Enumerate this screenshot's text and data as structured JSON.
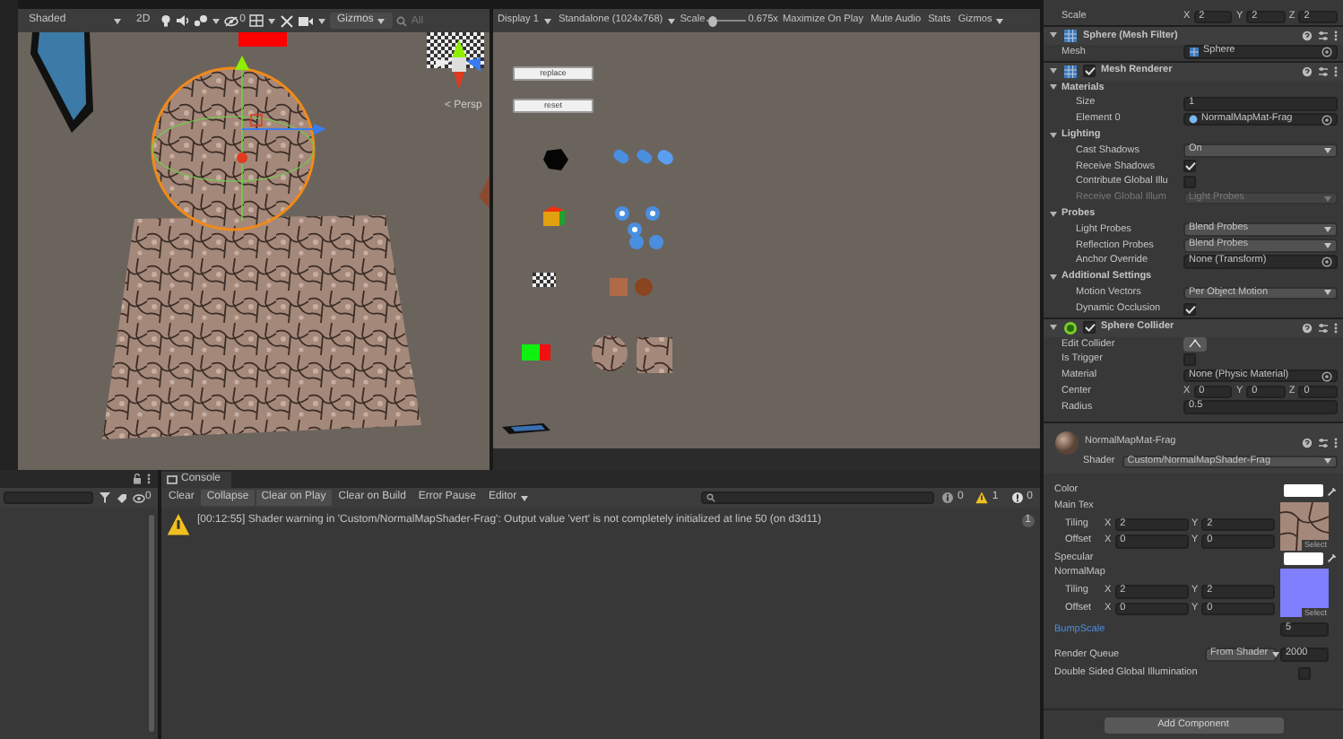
{
  "scene": {
    "toolbar": {
      "shading": "Shaded",
      "mode_2d": "2D",
      "effects_count": "0",
      "gizmos": "Gizmos",
      "search_placeholder": "All"
    },
    "camera_label": "< Persp"
  },
  "game": {
    "toolbar": {
      "display": "Display 1",
      "resolution": "Standalone (1024x768)",
      "scale_label": "Scale",
      "scale": {
        "level": 0.06
      },
      "scale_value": "0.675x",
      "toggles": [
        {
          "label": "Maximize On Play",
          "selected": false
        },
        {
          "label": "Mute Audio",
          "selected": false
        },
        {
          "label": "Stats",
          "selected": false
        }
      ],
      "gizmos": "Gizmos"
    },
    "ui_buttons": [
      "replace",
      "reset"
    ]
  },
  "hierarchy": {
    "hidden_count": "0"
  },
  "console": {
    "title": "Console",
    "toolbar": [
      {
        "label": "Clear",
        "selected": false
      },
      {
        "label": "Collapse",
        "selected": true
      },
      {
        "label": "Clear on Play",
        "selected": true
      },
      {
        "label": "Clear on Build",
        "selected": false
      },
      {
        "label": "Error Pause",
        "selected": false
      }
    ],
    "editor": "Editor",
    "counts": [
      {
        "kind": "info",
        "value": "0"
      },
      {
        "kind": "warning",
        "value": "1"
      },
      {
        "kind": "error",
        "value": "0"
      }
    ],
    "messages": [
      {
        "kind": "warning",
        "text": "[00:12:55] Shader warning in 'Custom/NormalMapShader-Frag': Output value 'vert' is not completely initialized at line 50 (on d3d11)",
        "count": "1"
      }
    ]
  },
  "inspector": {
    "rows": [
      {
        "kind": "vector",
        "label": "Scale",
        "values": [
          {
            "axis": "X",
            "value": "2"
          },
          {
            "axis": "Y",
            "value": "2"
          },
          {
            "axis": "Z",
            "value": "2"
          }
        ]
      },
      {
        "kind": "mesh_component",
        "title": "Sphere (Mesh Filter)"
      },
      {
        "kind": "mesh_object",
        "label": "Mesh",
        "value": "Sphere"
      },
      {
        "kind": "mesh_component",
        "title": "Mesh Renderer",
        "enabled": true
      },
      {
        "kind": "section",
        "label": "Materials",
        "expanded": true,
        "children": [
          {
            "kind": "field",
            "label": "Size",
            "value": "1"
          },
          {
            "kind": "material_object",
            "label": "Element 0",
            "value": "NormalMapMat-Frag"
          }
        ]
      },
      {
        "kind": "section",
        "label": "Lighting",
        "expanded": true,
        "children": [
          {
            "kind": "dropdown",
            "label": "Cast Shadows",
            "value": "On",
            "disabled": false
          },
          {
            "kind": "check",
            "label": "Receive Shadows",
            "checked": true
          },
          {
            "kind": "check",
            "label": "Contribute Global Illu",
            "checked": false
          },
          {
            "kind": "dropdown",
            "label": "Receive Global Illum",
            "value": "Light Probes",
            "disabled": true
          }
        ]
      },
      {
        "kind": "section",
        "label": "Probes",
        "expanded": true,
        "children": [
          {
            "kind": "dropdown",
            "label": "Light Probes",
            "value": "Blend Probes",
            "disabled": false
          },
          {
            "kind": "dropdown",
            "label": "Reflection Probes",
            "value": "Blend Probes",
            "disabled": false
          },
          {
            "kind": "object",
            "label": "Anchor Override",
            "value": "None (Transform)"
          }
        ]
      },
      {
        "kind": "section",
        "label": "Additional Settings",
        "expanded": true,
        "children": [
          {
            "kind": "dropdown",
            "label": "Motion Vectors",
            "value": "Per Object Motion",
            "disabled": false
          },
          {
            "kind": "check",
            "label": "Dynamic Occlusion",
            "checked": true
          }
        ]
      },
      {
        "kind": "collider_component",
        "title": "Sphere Collider",
        "enabled": true
      },
      {
        "kind": "button",
        "label": "Edit Collider"
      },
      {
        "kind": "check",
        "label": "Is Trigger",
        "checked": false
      },
      {
        "kind": "object",
        "label": "Material",
        "value": "None (Physic Material)"
      },
      {
        "kind": "vector",
        "label": "Center",
        "values": [
          {
            "axis": "X",
            "value": "0"
          },
          {
            "axis": "Y",
            "value": "0"
          },
          {
            "axis": "Z",
            "value": "0"
          }
        ]
      },
      {
        "kind": "field",
        "label": "Radius",
        "value": "0.5"
      }
    ]
  },
  "material": {
    "name": "NormalMapMat-Frag",
    "shader_label": "Shader",
    "shader": "Custom/NormalMapShader-Frag",
    "properties": [
      {
        "kind": "color",
        "label": "Color",
        "color": "#ffffff"
      },
      {
        "kind": "texture",
        "label": "Main Tex",
        "select": "Select",
        "tiling": {
          "label": "Tiling",
          "values": [
            {
              "axis": "X",
              "value": "2"
            },
            {
              "axis": "Y",
              "value": "2"
            }
          ]
        },
        "offset": {
          "label": "Offset",
          "values": [
            {
              "axis": "X",
              "value": "0"
            },
            {
              "axis": "Y",
              "value": "0"
            }
          ]
        }
      },
      {
        "kind": "color",
        "label": "Specular",
        "color": "#ffffff"
      },
      {
        "kind": "normal_map",
        "label": "NormalMap",
        "select": "Select",
        "tiling": {
          "label": "Tiling",
          "values": [
            {
              "axis": "X",
              "value": "2"
            },
            {
              "axis": "Y",
              "value": "2"
            }
          ]
        },
        "offset": {
          "label": "Offset",
          "values": [
            {
              "axis": "X",
              "value": "0"
            },
            {
              "axis": "Y",
              "value": "0"
            }
          ]
        }
      },
      {
        "kind": "float",
        "label": "BumpScale",
        "value": "5",
        "highlighted": true
      }
    ],
    "render_queue": {
      "label": "Render Queue",
      "mode": "From Shader",
      "value": "2000"
    },
    "double_sided": {
      "label": "Double Sided Global Illumination",
      "checked": false
    }
  },
  "add_component": "Add Component"
}
